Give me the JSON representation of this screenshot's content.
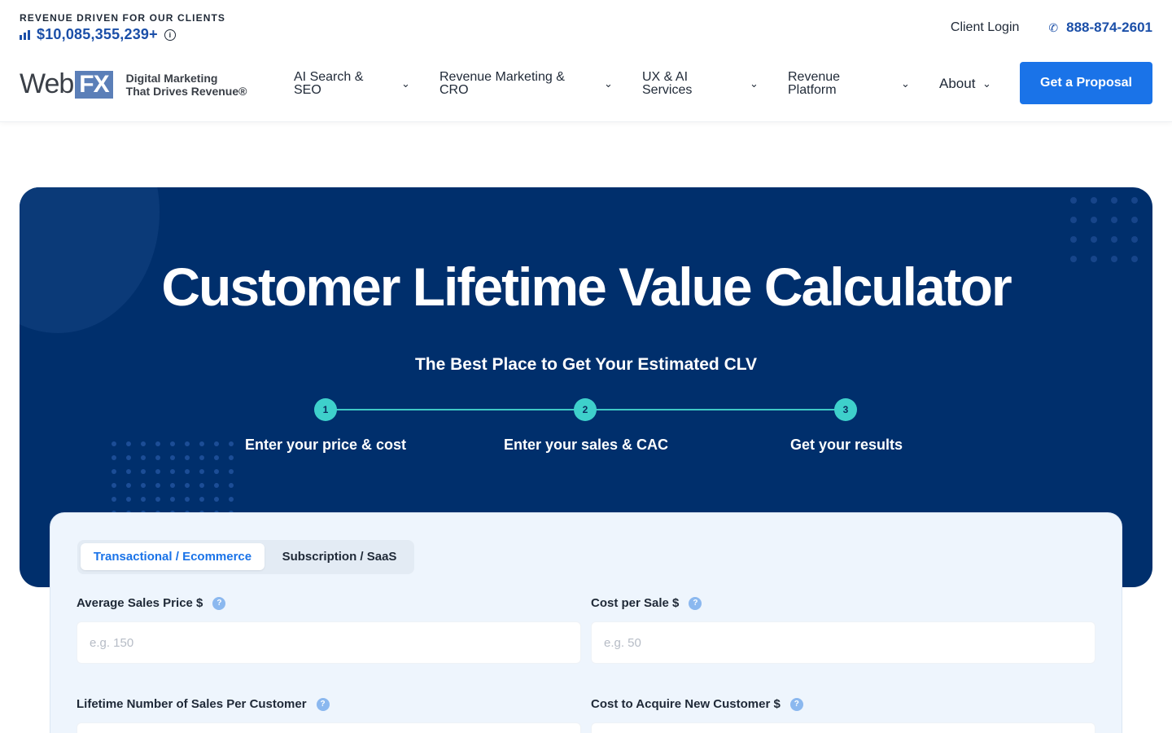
{
  "header": {
    "revenue_kicker": "REVENUE DRIVEN FOR OUR CLIENTS",
    "revenue_amount": "$10,085,355,239+",
    "client_login": "Client Login",
    "phone": "888-874-2601",
    "logo_web": "Web",
    "logo_fx": "FX",
    "tagline_line1": "Digital Marketing",
    "tagline_line2": "That Drives Revenue®",
    "nav": [
      {
        "line1": "AI Search &",
        "line2": "SEO"
      },
      {
        "line1": "Revenue Marketing &",
        "line2": "CRO"
      },
      {
        "line1": "UX & AI",
        "line2": "Services"
      },
      {
        "line1": "Revenue",
        "line2": "Platform"
      },
      {
        "line1": "About",
        "line2": ""
      }
    ],
    "cta": "Get a Proposal"
  },
  "hero": {
    "title": "Customer Lifetime Value Calculator",
    "subtitle": "The Best Place to Get Your Estimated CLV",
    "steps": [
      {
        "number": "1",
        "label": "Enter your price & cost"
      },
      {
        "number": "2",
        "label": "Enter your sales & CAC"
      },
      {
        "number": "3",
        "label": "Get your results"
      }
    ]
  },
  "form": {
    "tabs": [
      {
        "label": "Transactional / Ecommerce",
        "active": true
      },
      {
        "label": "Subscription / SaaS",
        "active": false
      }
    ],
    "fields": {
      "avg_sales_price": {
        "label": "Average Sales Price $",
        "placeholder": "e.g. 150",
        "value": ""
      },
      "cost_per_sale": {
        "label": "Cost per Sale $",
        "placeholder": "e.g. 50",
        "value": ""
      },
      "lifetime_sales": {
        "label": "Lifetime Number of Sales Per Customer",
        "placeholder": "",
        "value": ""
      },
      "cac": {
        "label": "Cost to Acquire New Customer $",
        "placeholder": "",
        "value": ""
      }
    },
    "help_glyph": "?"
  },
  "colors": {
    "brand_blue": "#1a73e8",
    "hero_navy": "#002f6c",
    "step_teal": "#3ed0cb",
    "revenue_blue": "#1b4fa8"
  },
  "icons": {
    "revenue": "bar-chart-icon",
    "info": "info-icon",
    "phone": "phone-icon",
    "chevron": "chevron-down-icon",
    "help": "question-icon"
  }
}
